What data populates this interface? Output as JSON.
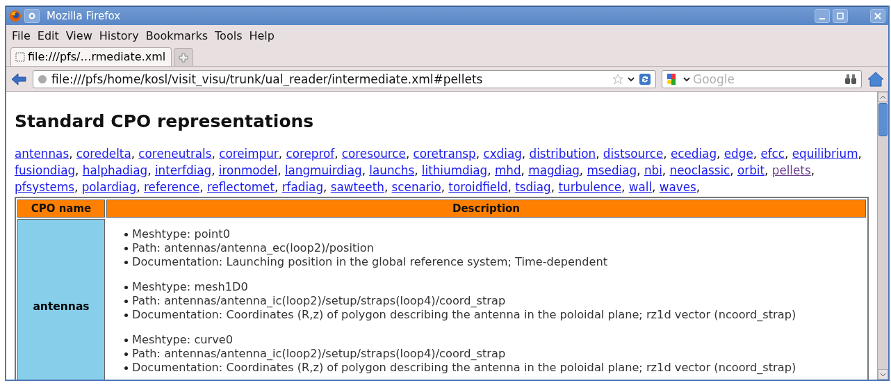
{
  "window": {
    "title": "Mozilla Firefox"
  },
  "menu": [
    "File",
    "Edit",
    "View",
    "History",
    "Bookmarks",
    "Tools",
    "Help"
  ],
  "tabs": [
    {
      "label": "file:///pfs/…rmediate.xml",
      "selected": true
    }
  ],
  "address": {
    "value": "file:///pfs/home/kosl/visit_visu/trunk/ual_reader/intermediate.xml#pellets"
  },
  "search": {
    "placeholder": "Google"
  },
  "page": {
    "heading": "Standard CPO representations",
    "links": [
      {
        "text": "antennas",
        "visited": false
      },
      {
        "text": "coredelta",
        "visited": false
      },
      {
        "text": "coreneutrals",
        "visited": false
      },
      {
        "text": "coreimpur",
        "visited": false
      },
      {
        "text": "coreprof",
        "visited": false
      },
      {
        "text": "coresource",
        "visited": false
      },
      {
        "text": "coretransp",
        "visited": false
      },
      {
        "text": "cxdiag",
        "visited": false
      },
      {
        "text": "distribution",
        "visited": false
      },
      {
        "text": "distsource",
        "visited": false
      },
      {
        "text": "ecediag",
        "visited": false
      },
      {
        "text": "edge",
        "visited": false
      },
      {
        "text": "efcc",
        "visited": false
      },
      {
        "text": "equilibrium",
        "visited": false
      },
      {
        "text": "fusiondiag",
        "visited": false
      },
      {
        "text": "halphadiag",
        "visited": false
      },
      {
        "text": "interfdiag",
        "visited": false
      },
      {
        "text": "ironmodel",
        "visited": false
      },
      {
        "text": "langmuirdiag",
        "visited": false
      },
      {
        "text": "launchs",
        "visited": false
      },
      {
        "text": "lithiumdiag",
        "visited": false
      },
      {
        "text": "mhd",
        "visited": false
      },
      {
        "text": "magdiag",
        "visited": false
      },
      {
        "text": "msediag",
        "visited": false
      },
      {
        "text": "nbi",
        "visited": false
      },
      {
        "text": "neoclassic",
        "visited": false
      },
      {
        "text": "orbit",
        "visited": false
      },
      {
        "text": "pellets",
        "visited": true
      },
      {
        "text": "pfsystems",
        "visited": false
      },
      {
        "text": "polardiag",
        "visited": false
      },
      {
        "text": "reference",
        "visited": false
      },
      {
        "text": "reflectomet",
        "visited": false
      },
      {
        "text": "rfadiag",
        "visited": false
      },
      {
        "text": "sawteeth",
        "visited": false
      },
      {
        "text": "scenario",
        "visited": false
      },
      {
        "text": "toroidfield",
        "visited": false
      },
      {
        "text": "tsdiag",
        "visited": false
      },
      {
        "text": "turbulence",
        "visited": false
      },
      {
        "text": "wall",
        "visited": false
      },
      {
        "text": "waves",
        "visited": false
      }
    ],
    "separator": ",",
    "table": {
      "columns": [
        "CPO name",
        "Description"
      ],
      "rows": [
        {
          "name": "antennas",
          "groups": [
            [
              "Meshtype: point0",
              "Path: antennas/antenna_ec(loop2)/position",
              "Documentation: Launching position in the global reference system; Time-dependent"
            ],
            [
              "Meshtype: mesh1D0",
              "Path: antennas/antenna_ic(loop2)/setup/straps(loop4)/coord_strap",
              "Documentation: Coordinates (R,z) of polygon describing the antenna in the poloidal plane; rz1d vector (ncoord_strap)"
            ],
            [
              "Meshtype: curve0",
              "Path: antennas/antenna_ic(loop2)/setup/straps(loop4)/coord_strap",
              "Documentation: Coordinates (R,z) of polygon describing the antenna in the poloidal plane; rz1d vector (ncoord_strap)"
            ]
          ]
        }
      ]
    }
  }
}
